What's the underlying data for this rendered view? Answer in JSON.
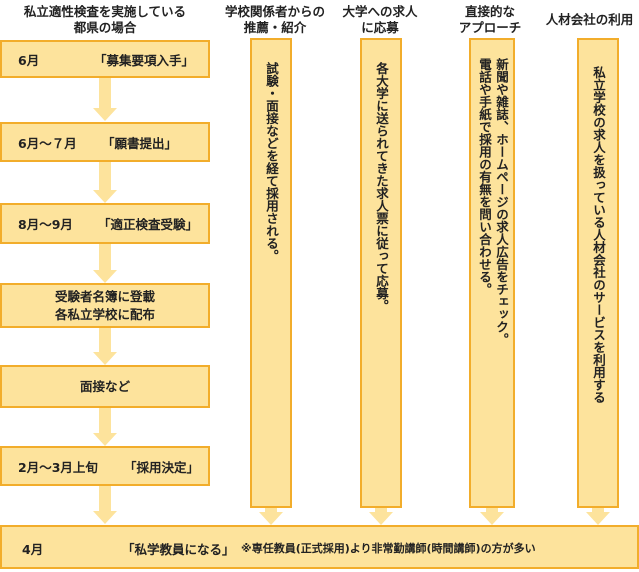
{
  "headers": {
    "h1": [
      "私立適性検査を実施している",
      "都県の場合"
    ],
    "h2": [
      "学校関係者からの",
      "推薦・紹介"
    ],
    "h3": [
      "大学への求人",
      "に応募"
    ],
    "h4": [
      "直接的な",
      "アプローチ"
    ],
    "h5": [
      "人材会社の利用"
    ]
  },
  "flow": {
    "step1": {
      "month": "6月",
      "text": "「募集要項入手」"
    },
    "step2": {
      "month": "6月～７月",
      "text": "「願書提出」"
    },
    "step3": {
      "month": "8月～9月",
      "text": "「適正検査受験」"
    },
    "step4": {
      "line1": "受験者名簿に登載",
      "line2": "各私立学校に配布"
    },
    "step5": {
      "text": "面接など"
    },
    "step6": {
      "month": "2月～3月上旬",
      "text": "「採用決定」"
    }
  },
  "columns": {
    "c1": [
      "試験・面接などを経て採用される。"
    ],
    "c2": [
      "各大学に送られてきた求人票に従って応募。"
    ],
    "c3": [
      "新聞や雑誌、ホームページの求人広告をチェック。",
      "電話や手紙で採用の有無を問い合わせる。"
    ],
    "c4": [
      "私立学校の求人を扱っている人材会社のサービスを利用する"
    ]
  },
  "result": {
    "month": "4月",
    "text": "「私学教員になる」",
    "note": "※専任教員(正式採用)より非常勤講師(時間講師)の方が多い"
  },
  "colors": {
    "fill": "#fde39c",
    "border": "#f2ad2b"
  }
}
